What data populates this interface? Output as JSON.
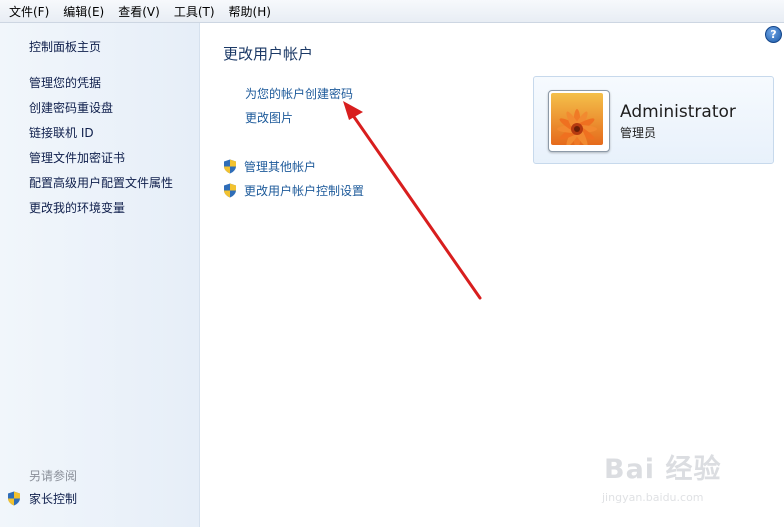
{
  "menubar": {
    "items": [
      "文件(F)",
      "编辑(E)",
      "查看(V)",
      "工具(T)",
      "帮助(H)"
    ]
  },
  "sidebar": {
    "home": "控制面板主页",
    "links": [
      "管理您的凭据",
      "创建密码重设盘",
      "链接联机 ID",
      "管理文件加密证书",
      "配置高级用户配置文件属性",
      "更改我的环境变量"
    ],
    "see_also_heading": "另请参阅",
    "parental_controls": "家长控制"
  },
  "main": {
    "title": "更改用户帐户",
    "create_password": "为您的帐户创建密码",
    "change_picture": "更改图片",
    "manage_other_accounts": "管理其他帐户",
    "uac_settings": "更改用户帐户控制设置",
    "help_label": "?"
  },
  "user_card": {
    "name": "Administrator",
    "role": "管理员"
  },
  "watermark": {
    "logo": "Bai 经验",
    "url": "jingyan.baidu.com"
  },
  "colors": {
    "link": "#1d5a9a",
    "title": "#1b3966",
    "arrow": "#d81e1e",
    "sidebar_bg": "#eaf1f9"
  },
  "icons": {
    "shield": "uac-shield-icon",
    "help": "help-icon",
    "avatar": "flower-avatar-icon"
  }
}
